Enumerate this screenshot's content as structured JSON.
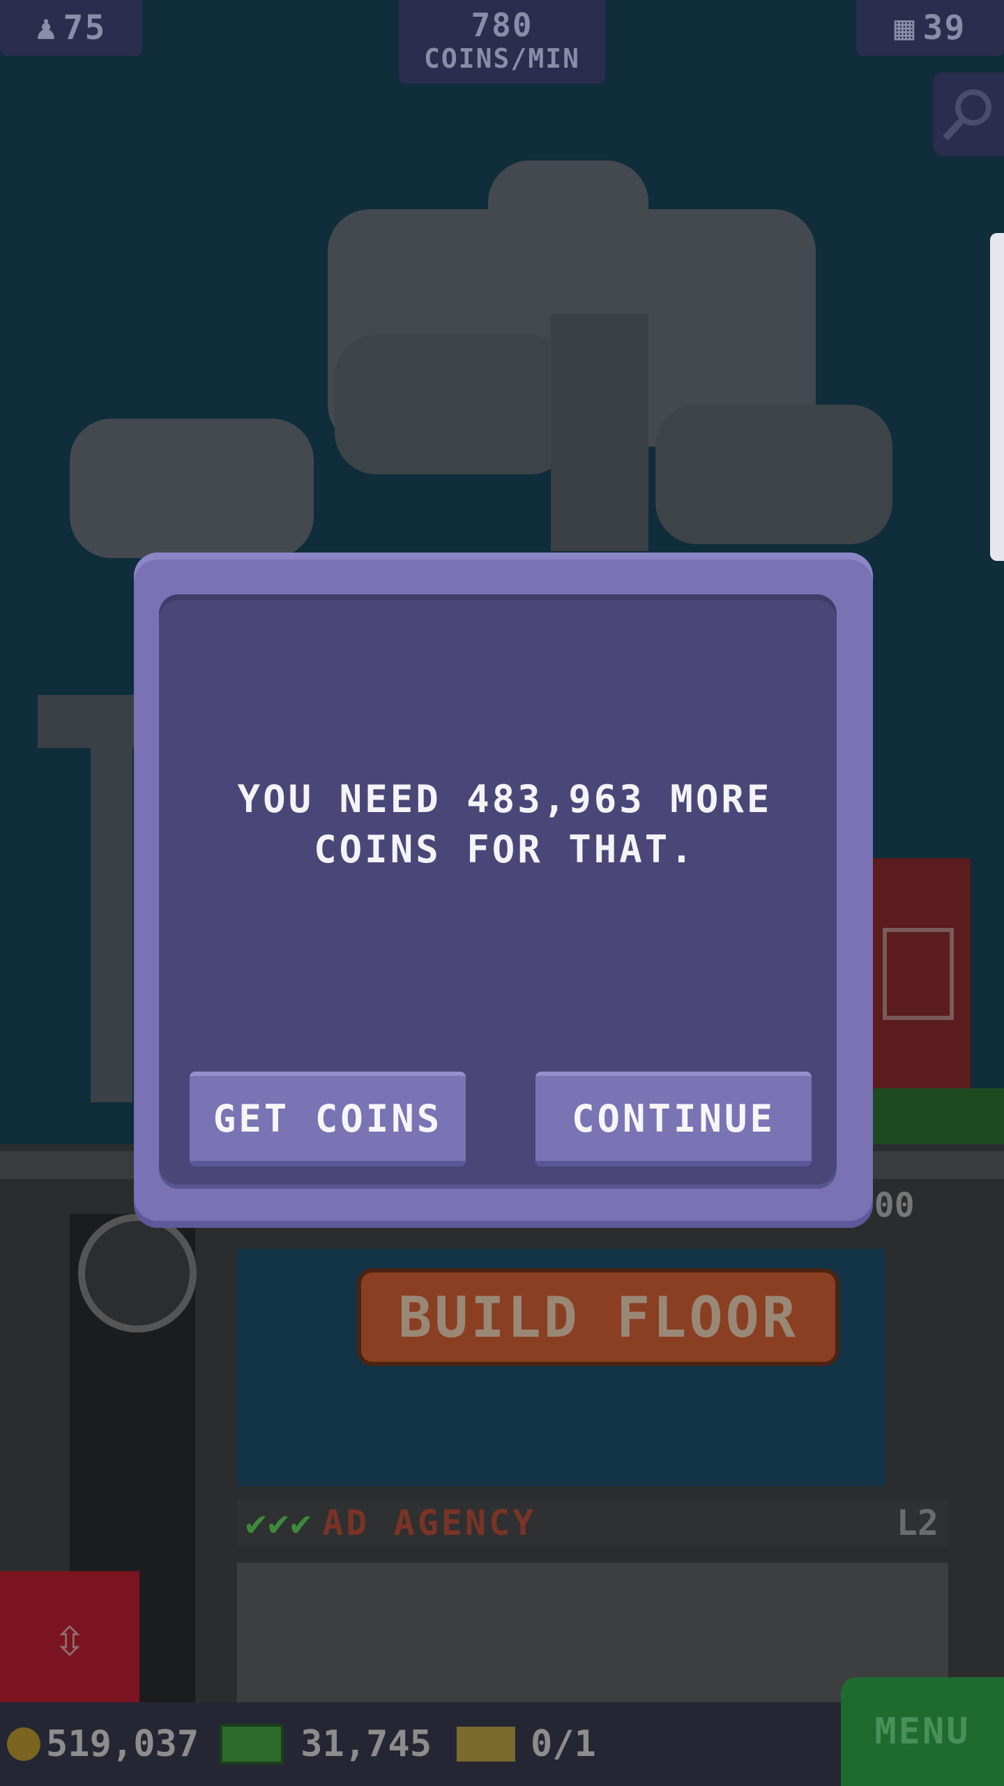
{
  "hud": {
    "population": "75",
    "coins_per_min_value": "780",
    "coins_per_min_label": "COINS/MIN",
    "floors": "39"
  },
  "scene": {
    "build_floor_label": "BUILD FLOOR",
    "floor_name": "AD AGENCY",
    "floor_checks": "✔✔✔",
    "floor_level": "L2",
    "cost_partial": ",000"
  },
  "modal": {
    "message": "YOU NEED 483,963 MORE COINS FOR THAT.",
    "get_coins_label": "GET COINS",
    "continue_label": "CONTINUE"
  },
  "bottom_bar": {
    "coins": "519,037",
    "bux": "31,745",
    "tickets": "0/1",
    "menu_label": "MENU"
  },
  "colors": {
    "modal_frame": "#7a72b4",
    "modal_inner": "#4a4778",
    "menu_button": "#1f6a2f"
  }
}
